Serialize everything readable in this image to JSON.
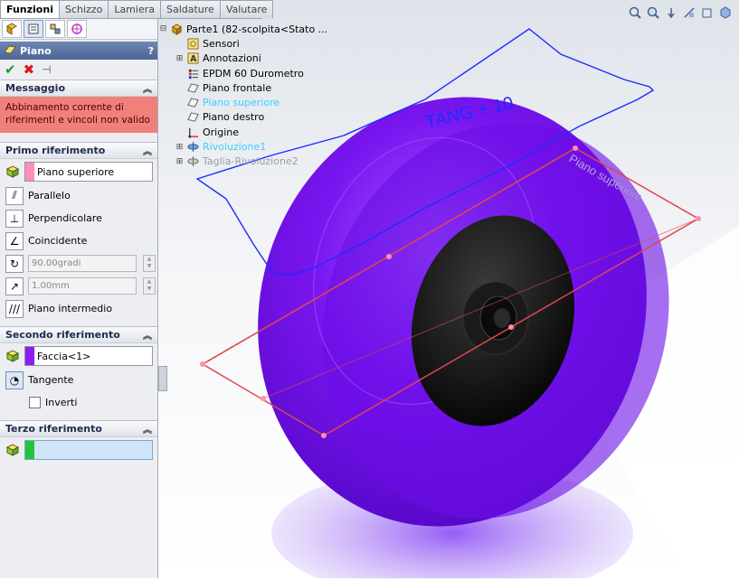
{
  "tabs": [
    "Funzioni",
    "Schizzo",
    "Lamiera",
    "Saldature",
    "Valutare"
  ],
  "active_tab": "Funzioni",
  "property_manager": {
    "title": "Piano",
    "help": "?",
    "icons": [
      "feature-manager-icon",
      "property-manager-icon",
      "configuration-manager-icon",
      "dimxpert-icon"
    ]
  },
  "message": {
    "header": "Messaggio",
    "text": "Abbinamento corrente di riferimenti e vincoli non valido"
  },
  "first_reference": {
    "header": "Primo riferimento",
    "selection": "Piano superiore",
    "swatch_color": "#ff8fb8",
    "options": [
      "Parallelo",
      "Perpendicolare",
      "Coincidente"
    ],
    "angle": "90.00gradi",
    "distance": "1.00mm",
    "midplane": "Piano intermedio"
  },
  "second_reference": {
    "header": "Secondo riferimento",
    "selection": "Faccia<1>",
    "swatch_color": "#8a1ff0",
    "option": "Tangente",
    "invert": "Inverti"
  },
  "third_reference": {
    "header": "Terzo riferimento",
    "selection": "",
    "swatch_color": "#22c43a"
  },
  "tree": [
    {
      "label": "Parte1  (82-scolpita<Stato ...",
      "icon": "part-icon",
      "expand": "",
      "style": ""
    },
    {
      "label": "Sensori",
      "icon": "sensor-icon",
      "expand": "",
      "style": ""
    },
    {
      "label": "Annotazioni",
      "icon": "annotation-icon",
      "expand": "+",
      "style": ""
    },
    {
      "label": "EPDM 60 Durometro",
      "icon": "material-icon",
      "expand": "",
      "style": ""
    },
    {
      "label": "Piano frontale",
      "icon": "plane-icon",
      "expand": "",
      "style": ""
    },
    {
      "label": "Piano superiore",
      "icon": "plane-icon",
      "expand": "",
      "style": "hl"
    },
    {
      "label": "Piano destro",
      "icon": "plane-icon",
      "expand": "",
      "style": ""
    },
    {
      "label": "Origine",
      "icon": "origin-icon",
      "expand": "",
      "style": ""
    },
    {
      "label": "Rivoluzione1",
      "icon": "revolve-icon",
      "expand": "+",
      "style": "hl"
    },
    {
      "label": "Taglia-Rivoluzione2",
      "icon": "cut-revolve-icon",
      "expand": "+",
      "style": "dim"
    }
  ],
  "viewport": {
    "plane_label": "Piano superiore",
    "sketch_text": "TANG + 10",
    "tire_color": "#7a16f0",
    "plane_color": "#e0454f",
    "sketch_color": "#1c2cff"
  },
  "toolbar_icons": [
    "zoom-fit-icon",
    "zoom-area-icon",
    "previous-view-icon",
    "section-view-icon",
    "view-orientation-icon",
    "display-style-icon"
  ]
}
